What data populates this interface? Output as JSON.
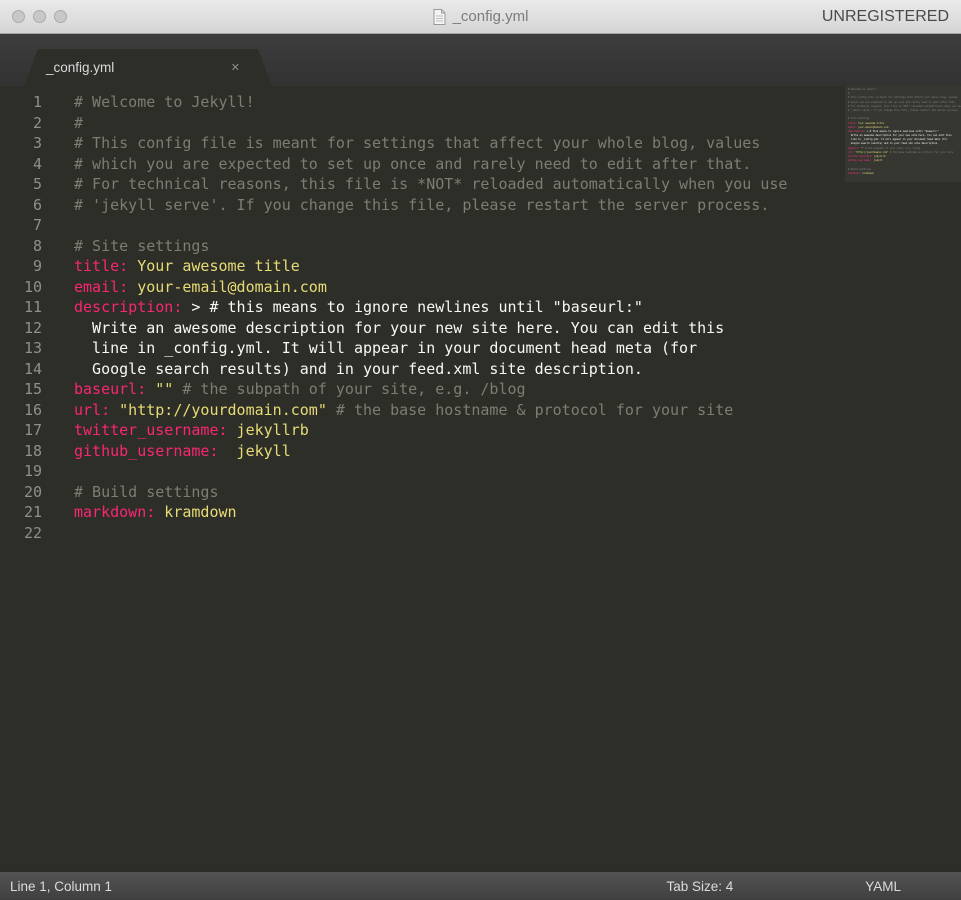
{
  "colors": {
    "editor-bg": "#2e2e29",
    "key": "#f92672",
    "string": "#e6db74",
    "comment": "#7d7d74",
    "plain": "#f8f8f2",
    "gutter": "#8f908a"
  },
  "titlebar": {
    "title": "_config.yml",
    "registration": "UNREGISTERED"
  },
  "tab": {
    "label": "_config.yml",
    "close_glyph": "✕"
  },
  "editor": {
    "lines": [
      {
        "n": 1,
        "segs": [
          {
            "t": "# Welcome to Jekyll!",
            "c": "comment"
          }
        ]
      },
      {
        "n": 2,
        "segs": [
          {
            "t": "#",
            "c": "comment"
          }
        ]
      },
      {
        "n": 3,
        "segs": [
          {
            "t": "# This config file is meant for settings that affect your whole blog, values",
            "c": "comment"
          }
        ]
      },
      {
        "n": 4,
        "segs": [
          {
            "t": "# which you are expected to set up once and rarely need to edit after that.",
            "c": "comment"
          }
        ]
      },
      {
        "n": 5,
        "segs": [
          {
            "t": "# For technical reasons, this file is *NOT* reloaded automatically when you use",
            "c": "comment"
          }
        ]
      },
      {
        "n": 6,
        "segs": [
          {
            "t": "# 'jekyll serve'. If you change this file, please restart the server process.",
            "c": "comment"
          }
        ]
      },
      {
        "n": 7,
        "segs": []
      },
      {
        "n": 8,
        "segs": [
          {
            "t": "# Site settings",
            "c": "comment"
          }
        ]
      },
      {
        "n": 9,
        "segs": [
          {
            "t": "title:",
            "c": "key"
          },
          {
            "t": " Your awesome title",
            "c": "str"
          }
        ]
      },
      {
        "n": 10,
        "segs": [
          {
            "t": "email:",
            "c": "key"
          },
          {
            "t": " your-email@domain.com",
            "c": "str"
          }
        ]
      },
      {
        "n": 11,
        "segs": [
          {
            "t": "description:",
            "c": "key"
          },
          {
            "t": " > # this means to ignore newlines until \"baseurl:\"",
            "c": "plain"
          }
        ]
      },
      {
        "n": 12,
        "segs": [
          {
            "t": "  Write an awesome description for your new site here. You can edit this",
            "c": "plain"
          }
        ]
      },
      {
        "n": 13,
        "segs": [
          {
            "t": "  line in _config.yml. It will appear in your document head meta (for",
            "c": "plain"
          }
        ]
      },
      {
        "n": 14,
        "segs": [
          {
            "t": "  Google search results) and in your feed.xml site description.",
            "c": "plain"
          }
        ]
      },
      {
        "n": 15,
        "segs": [
          {
            "t": "baseurl:",
            "c": "key"
          },
          {
            "t": " \"\"",
            "c": "str"
          },
          {
            "t": " # the subpath of your site, e.g. /blog",
            "c": "comment"
          }
        ]
      },
      {
        "n": 16,
        "segs": [
          {
            "t": "url:",
            "c": "key"
          },
          {
            "t": " \"http://yourdomain.com\"",
            "c": "str"
          },
          {
            "t": " # the base hostname & protocol for your site",
            "c": "comment"
          }
        ]
      },
      {
        "n": 17,
        "segs": [
          {
            "t": "twitter_username:",
            "c": "key"
          },
          {
            "t": " jekyllrb",
            "c": "str"
          }
        ]
      },
      {
        "n": 18,
        "segs": [
          {
            "t": "github_username:",
            "c": "key"
          },
          {
            "t": "  jekyll",
            "c": "str"
          }
        ]
      },
      {
        "n": 19,
        "segs": []
      },
      {
        "n": 20,
        "segs": [
          {
            "t": "# Build settings",
            "c": "comment"
          }
        ]
      },
      {
        "n": 21,
        "segs": [
          {
            "t": "markdown:",
            "c": "key"
          },
          {
            "t": " kramdown",
            "c": "str"
          }
        ]
      },
      {
        "n": 22,
        "segs": []
      }
    ]
  },
  "statusbar": {
    "cursor": "Line 1, Column 1",
    "tab_size": "Tab Size: 4",
    "syntax": "YAML"
  }
}
